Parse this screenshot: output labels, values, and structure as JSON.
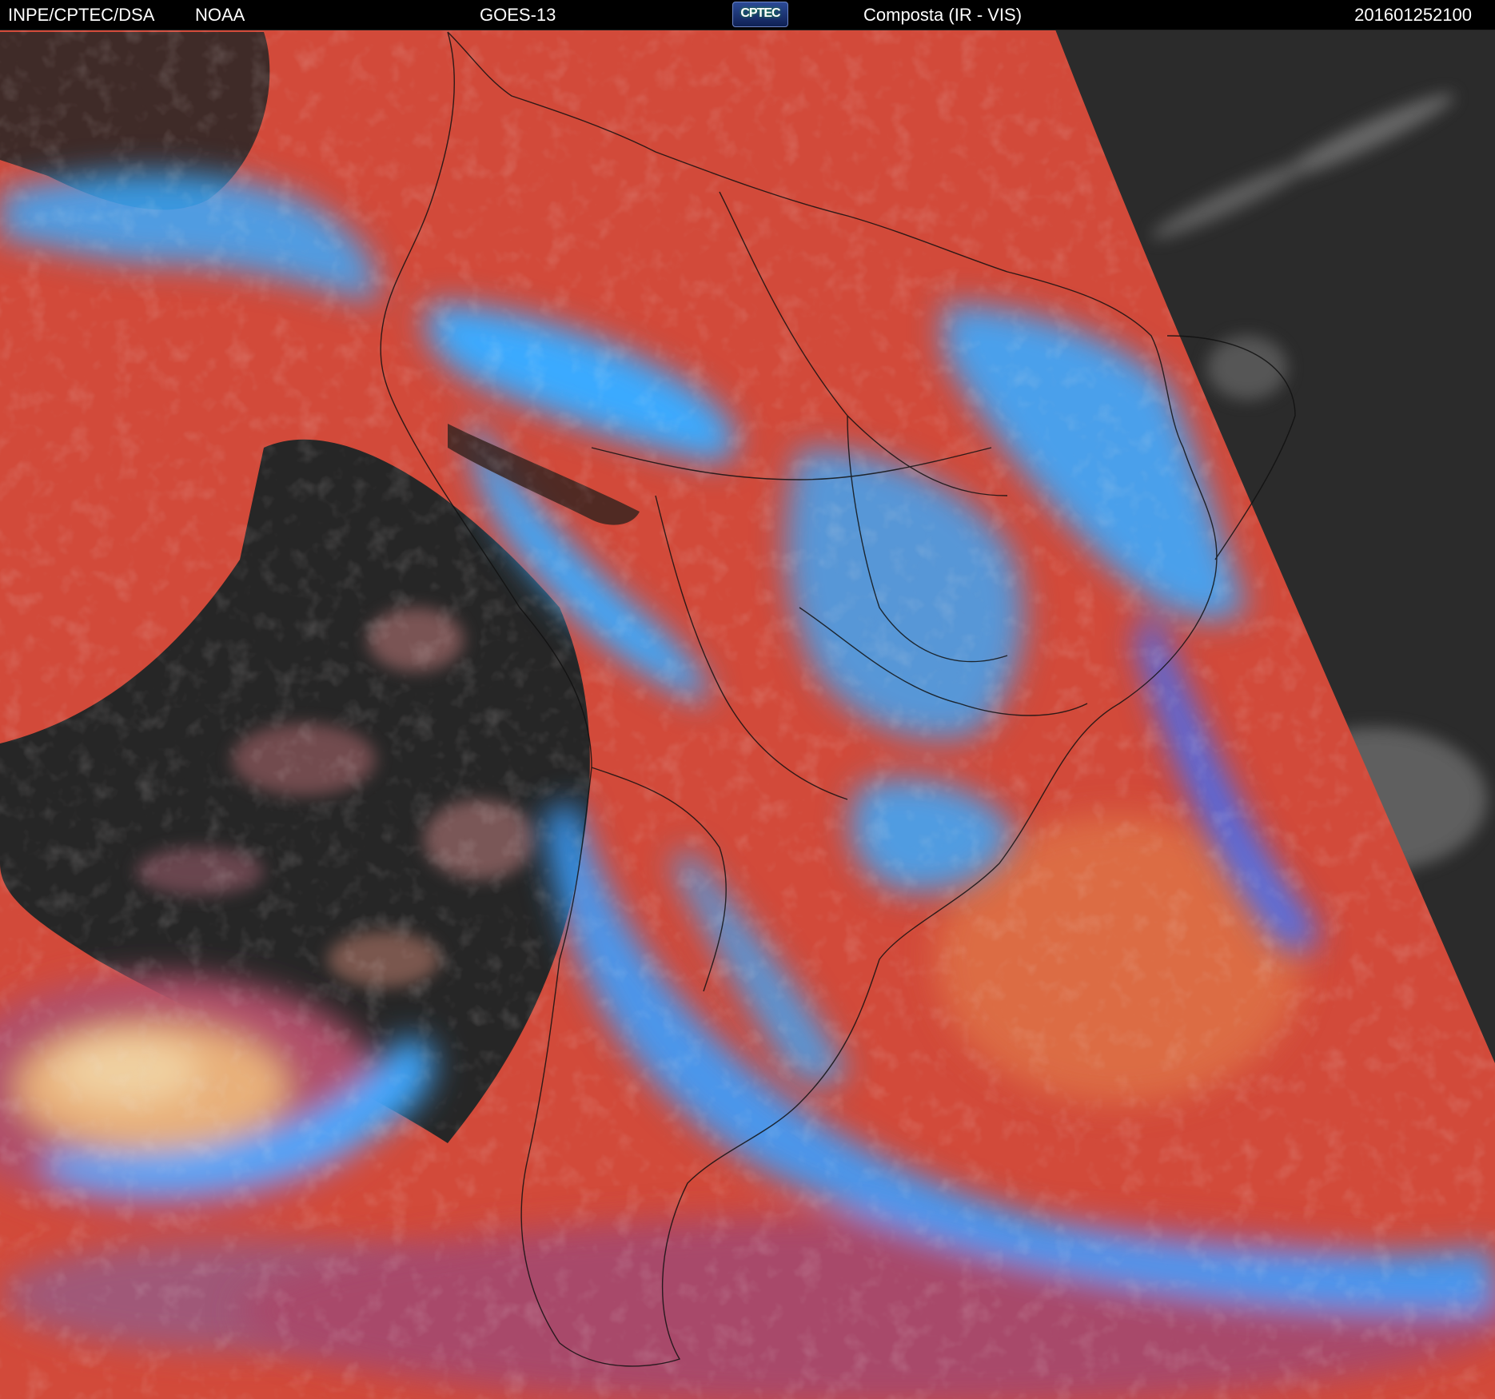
{
  "header": {
    "agency": "INPE/CPTEC/DSA",
    "partner": "NOAA",
    "satellite": "GOES-13",
    "logo_text": "CPTEC",
    "product": "Composta (IR - VIS)",
    "timestamp": "201601252100"
  },
  "colors": {
    "background": "#000000",
    "header_text": "#ffffff",
    "warm_surface": "#d24a3a",
    "deep_cloud": "#2fa8ff",
    "clear_ocean": "#262626",
    "night_side": "#2b2b2b"
  }
}
